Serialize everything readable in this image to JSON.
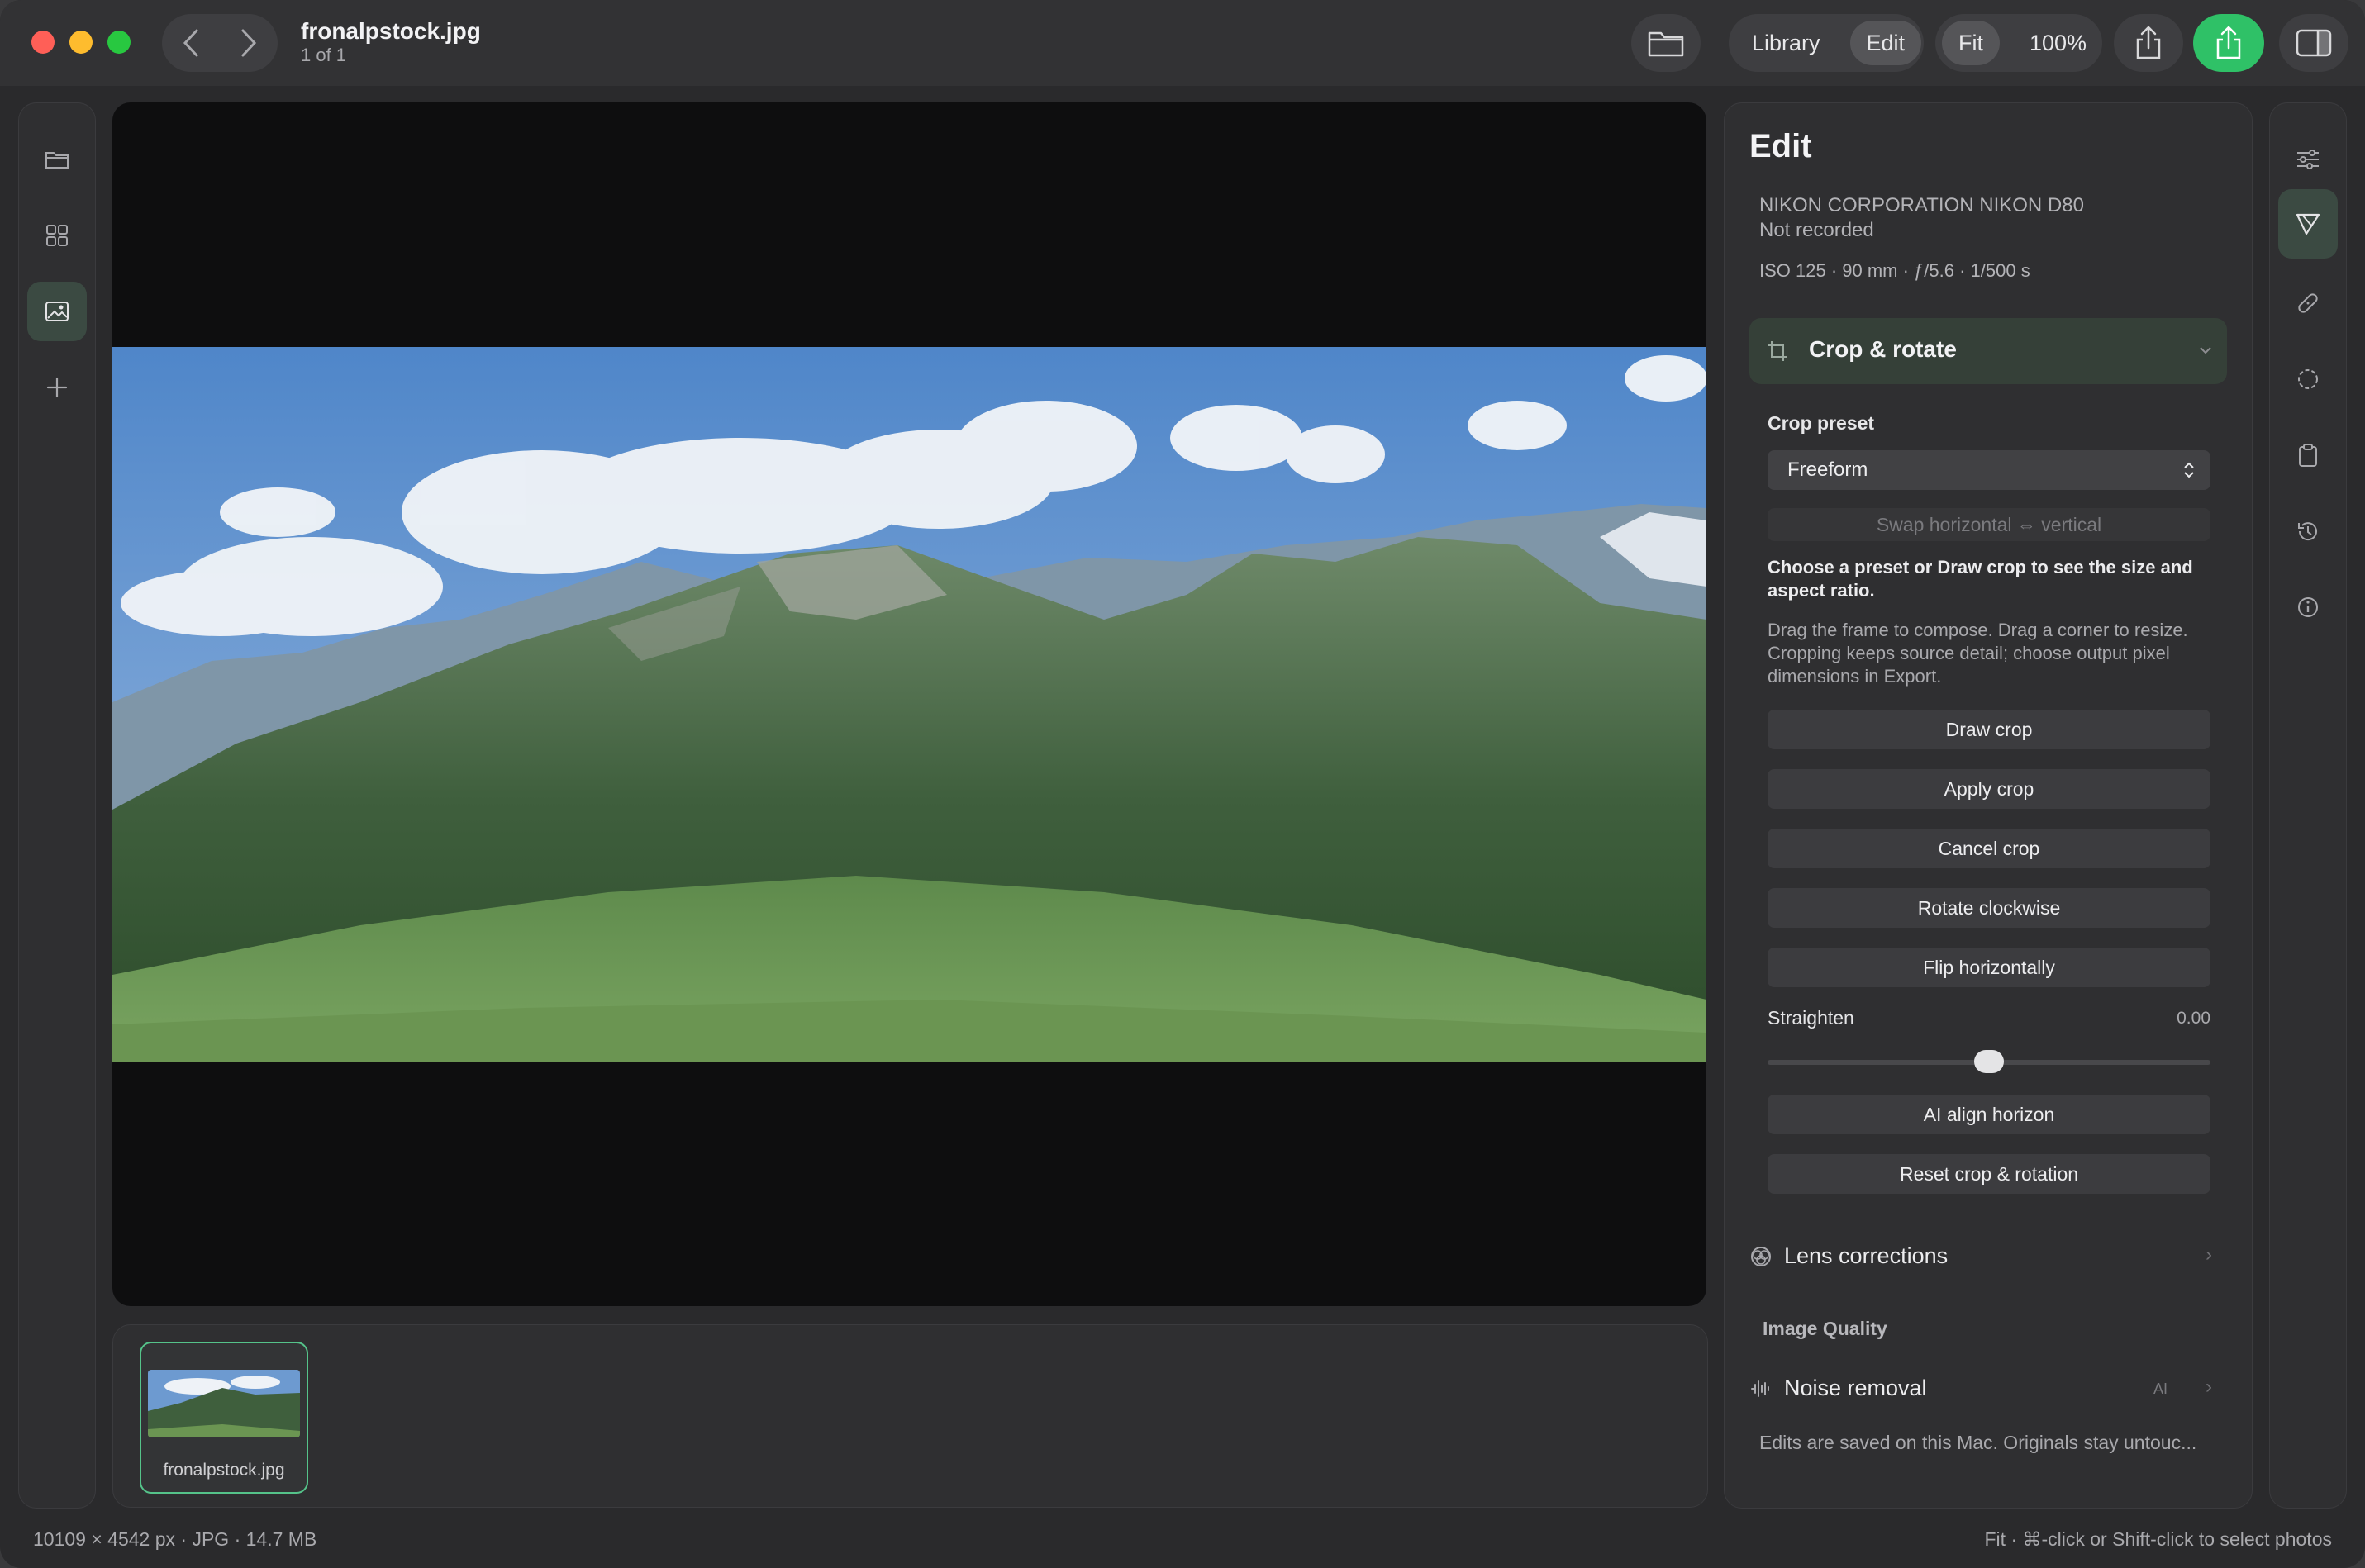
{
  "window": {
    "file_name": "fronalpstock.jpg",
    "position": "1 of 1"
  },
  "toolbar": {
    "library": "Library",
    "edit": "Edit",
    "fit": "Fit",
    "zoom": "100%"
  },
  "filmstrip": {
    "items": [
      {
        "label": "fronalpstock.jpg",
        "selected": true
      }
    ]
  },
  "edit_panel": {
    "title": "Edit",
    "camera": "NIKON CORPORATION NIKON D80",
    "lens": "Not recorded",
    "exposure": "ISO 125  ·  90 mm  ·  ƒ/5.6  ·  1/500 s",
    "crop_section": {
      "title": "Crop & rotate",
      "preset_label": "Crop preset",
      "preset_value": "Freeform",
      "swap_button": "Swap horizontal ⇔ vertical",
      "hint_bold": "Choose a preset or Draw crop to see the size and aspect ratio.",
      "hint": "Drag the frame to compose. Drag a corner to resize. Cropping keeps source detail; choose output pixel dimensions in Export.",
      "draw_crop": "Draw crop",
      "apply_crop": "Apply crop",
      "cancel_crop": "Cancel crop",
      "rotate_cw": "Rotate clockwise",
      "flip_h": "Flip horizontally",
      "straighten_label": "Straighten",
      "straighten_value": "0.00",
      "straighten_level": 0.5,
      "ai_align": "AI align horizon",
      "reset": "Reset crop & rotation"
    },
    "lens_corrections": "Lens corrections",
    "image_quality_label": "Image Quality",
    "noise_removal": "Noise removal",
    "noise_badge": "AI",
    "footer": "Edits are saved on this Mac. Originals stay untouc..."
  },
  "status": {
    "left": "10109 × 4542 px  ·  JPG  ·  14.7 MB",
    "right": "Fit · ⌘-click or Shift-click to select photos"
  },
  "colors": {
    "accent_green": "#2fc167",
    "selection_green": "#55c38a",
    "active_tool_bg": "#3b4a42"
  }
}
